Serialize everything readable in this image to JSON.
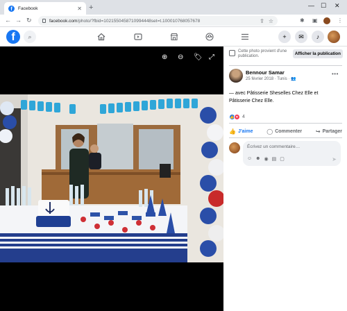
{
  "browser": {
    "tab_title": "Facebook",
    "tab_close": "✕",
    "new_tab": "+",
    "url_host": "facebook.com",
    "url_path": "/photo/?fbid=1021550458710994448set=t.100010768057678",
    "back": "←",
    "forward": "→",
    "reload": "↻",
    "minimize": "—",
    "maximize": "☐",
    "close": "✕"
  },
  "fb": {
    "logo": "f",
    "nav": [
      "home-icon",
      "watch-icon",
      "marketplace-icon",
      "groups-icon",
      "menu-icon"
    ],
    "brand_color": "#1877f2"
  },
  "viewer": {
    "zoom_in": "⊕",
    "zoom_out": "⊖",
    "tag": "🏷",
    "fullscreen": "⤢",
    "photo_banner": "HAPPY BIRTHDAY"
  },
  "panel": {
    "notice_text": "Cette photo provient d'une publication.",
    "notice_button": "Afficher la publication",
    "author": "Bennour Samar",
    "meta": "25 février 2018 · Tunis · ",
    "caption": "— avec Pâtisserie Sheselles Chez Elle et Pâtisserie Chez Elle.",
    "reaction_count": "4",
    "like_label": "J'aime",
    "comment_label": "Commenter",
    "share_label": "Partager",
    "comment_placeholder": "Écrivez un commentaire…"
  }
}
